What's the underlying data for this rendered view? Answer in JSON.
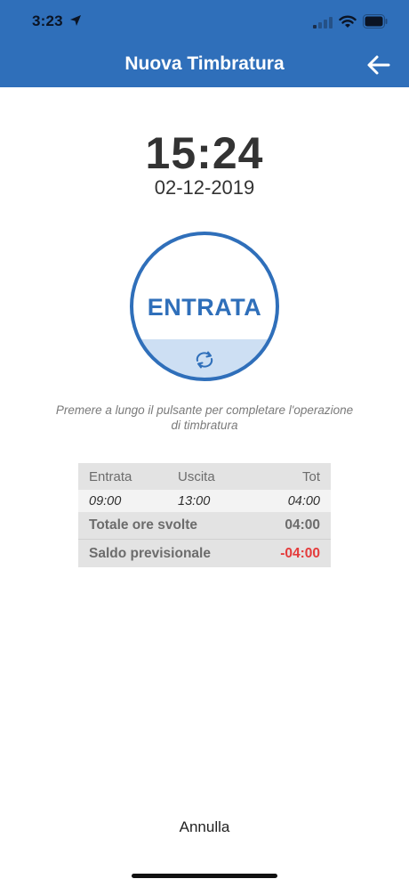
{
  "status_bar": {
    "time": "3:23"
  },
  "nav": {
    "title": "Nuova Timbratura",
    "back_icon": "arrow-left-icon"
  },
  "clock": {
    "time": "15:24",
    "date": "02-12-2019"
  },
  "punch_button": {
    "label": "ENTRATA",
    "icon": "refresh-icon",
    "colors": {
      "accent": "#2f6fba",
      "fill_light": "#cddff3"
    }
  },
  "instruction": "Premere a lungo il pulsante per completare l'operazione di timbratura",
  "summary": {
    "headers": [
      "Entrata",
      "Uscita",
      "Tot"
    ],
    "rows": [
      {
        "entrata": "09:00",
        "uscita": "13:00",
        "tot": "04:00"
      }
    ],
    "total_label": "Totale ore svolte",
    "total_value": "04:00",
    "saldo_label": "Saldo previsionale",
    "saldo_value": "-04:00",
    "saldo_color": "#e43b3b"
  },
  "footer": {
    "cancel_label": "Annulla"
  },
  "colors": {
    "header_bg": "#2f6fba",
    "text_dark": "#333333"
  }
}
